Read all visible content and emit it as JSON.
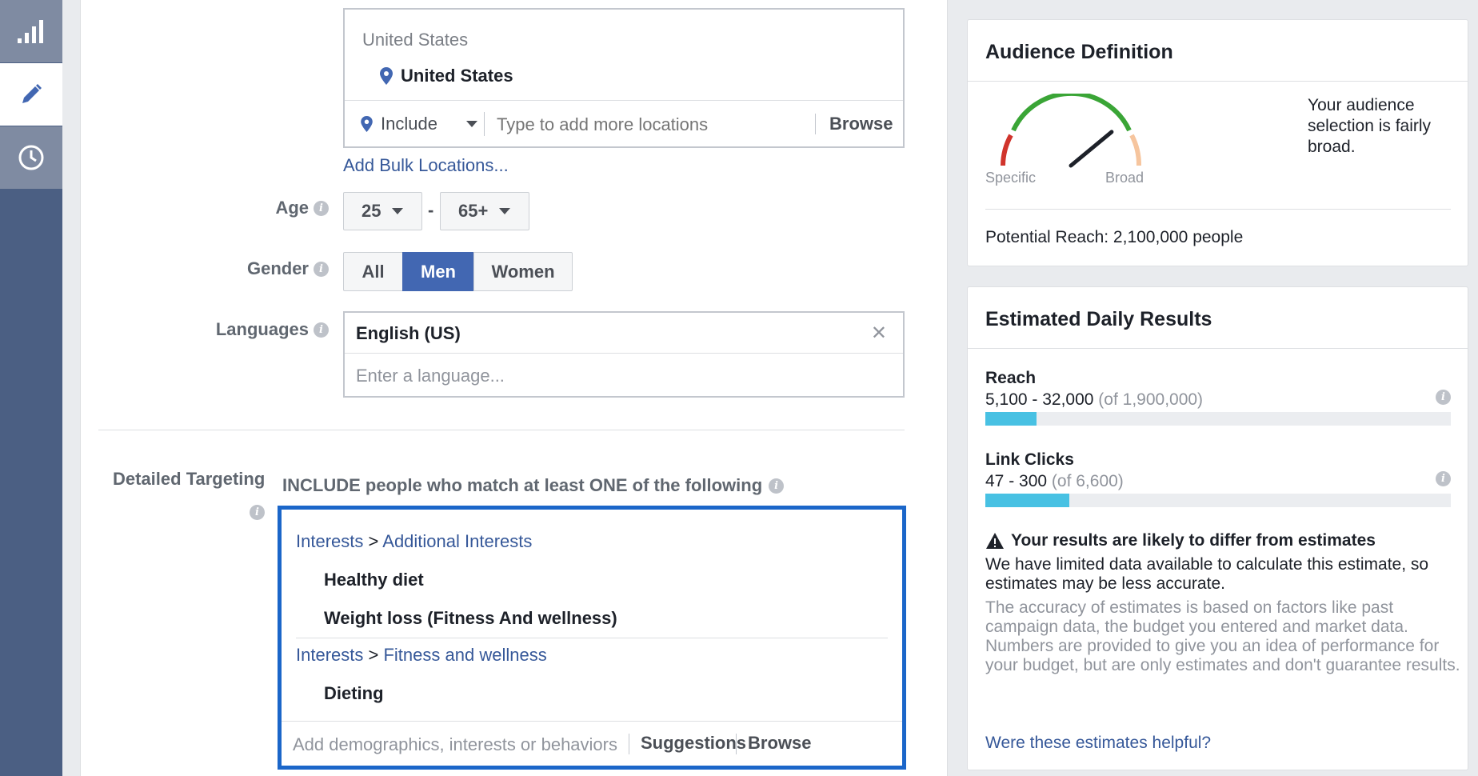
{
  "rail": {
    "items": [
      {
        "icon": "bar-chart-icon"
      },
      {
        "icon": "pencil-icon"
      },
      {
        "icon": "clock-icon"
      }
    ]
  },
  "location": {
    "header": "United States",
    "selected": "United States",
    "include_label": "Include",
    "input_placeholder": "Type to add more locations",
    "browse_label": "Browse",
    "bulk_link": "Add Bulk Locations..."
  },
  "age": {
    "label": "Age",
    "min": "25",
    "max": "65+",
    "separator": "-"
  },
  "gender": {
    "label": "Gender",
    "options": [
      "All",
      "Men",
      "Women"
    ],
    "selected": "Men"
  },
  "languages": {
    "label": "Languages",
    "selected": "English (US)",
    "placeholder": "Enter a language..."
  },
  "detailed_targeting": {
    "label": "Detailed Targeting",
    "instruction": "INCLUDE people who match at least ONE of the following",
    "groups": [
      {
        "category": "Interests",
        "separator": ">",
        "subcategory": "Additional Interests",
        "items": [
          "Healthy diet",
          "Weight loss (Fitness And wellness)"
        ]
      },
      {
        "category": "Interests",
        "separator": ">",
        "subcategory": "Fitness and wellness",
        "items": [
          "Dieting"
        ]
      }
    ],
    "input_placeholder": "Add demographics, interests or behaviors",
    "suggestions_label": "Suggestions",
    "browse_label": "Browse"
  },
  "audience_definition": {
    "title": "Audience Definition",
    "gauge_left": "Specific",
    "gauge_right": "Broad",
    "gauge_level": 0.78,
    "description": "Your audience selection is fairly broad.",
    "potential_reach": "Potential Reach: 2,100,000 people"
  },
  "estimated_results": {
    "title": "Estimated Daily Results",
    "reach_label": "Reach",
    "reach_range": "5,100 - 32,000",
    "reach_total": "(of 1,900,000)",
    "reach_fraction": 0.11,
    "clicks_label": "Link Clicks",
    "clicks_range": "47 - 300",
    "clicks_total": "(of 6,600)",
    "clicks_fraction": 0.18,
    "warning_title": "Your results are likely to differ from estimates",
    "warning_body": "We have limited data available to calculate this estimate, so estimates may be less accurate.",
    "accuracy_note": "The accuracy of estimates is based on factors like past campaign data, the budget you entered and market data. Numbers are provided to give you an idea of performance for your budget, but are only estimates and don't guarantee results.",
    "feedback_link": "Were these estimates helpful?"
  },
  "colors": {
    "accent": "#4267b2",
    "link": "#365899",
    "focus_border": "#1b66c9",
    "bar": "#48c1e3",
    "rail": "#4b5f83"
  }
}
